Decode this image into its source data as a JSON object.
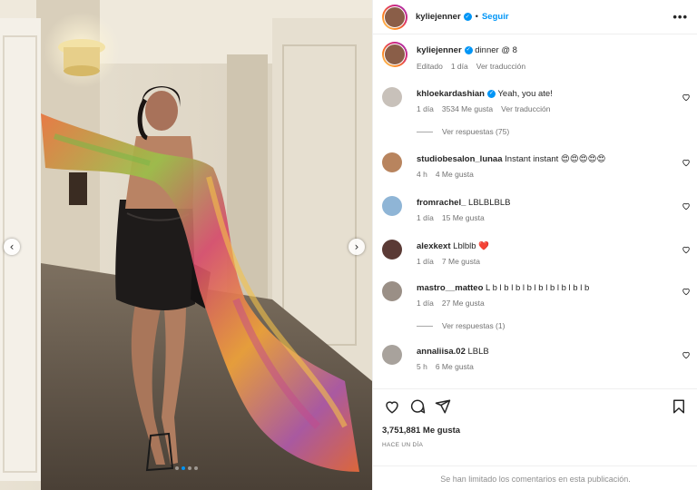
{
  "post": {
    "author": "kyliejenner",
    "follow_label": "Seguir",
    "separator": "•",
    "more_label": "•••"
  },
  "caption": {
    "username": "kyliejenner",
    "text": "dinner @ 8",
    "edited": "Editado",
    "time": "1 día",
    "translate": "Ver traducción"
  },
  "comments": [
    {
      "username": "khloekardashian",
      "verified": true,
      "text": "Yeah, you ate!",
      "time": "1 día",
      "likes": "3534 Me gusta",
      "translate": "Ver traducción",
      "replies": "Ver respuestas (75)"
    },
    {
      "username": "studiobesalon_lunaa",
      "verified": false,
      "text": "Instant instant 😍😍😍😍😍",
      "time": "4 h",
      "likes": "4 Me gusta"
    },
    {
      "username": "fromrachel_",
      "verified": false,
      "text": "LBLBLBLB",
      "time": "1 día",
      "likes": "15 Me gusta"
    },
    {
      "username": "alexkext",
      "verified": false,
      "text": "Lblblb ❤️",
      "time": "1 día",
      "likes": "7 Me gusta"
    },
    {
      "username": "mastro__matteo",
      "verified": false,
      "text": "L b l b l b l b l b l b l b l b l b",
      "time": "1 día",
      "likes": "27 Me gusta",
      "replies": "Ver respuestas (1)"
    },
    {
      "username": "annaliisa.02",
      "verified": false,
      "text": "LBLB",
      "time": "5 h",
      "likes": "6 Me gusta"
    }
  ],
  "footer": {
    "likes": "3,751,881 Me gusta",
    "time_ago": "HACE UN DÍA",
    "comments_limited": "Se han limitado los comentarios en esta publicación."
  },
  "carousel": {
    "prev_icon": "‹",
    "next_icon": "›",
    "slides": 4,
    "active_slide": 2
  },
  "colors": {
    "accent": "#0095f6",
    "meta": "#737373",
    "text": "#262626"
  },
  "icons": [
    "heart-icon",
    "comment-icon",
    "share-icon",
    "bookmark-icon",
    "verified-icon",
    "more-icon",
    "chevron-left-icon",
    "chevron-right-icon"
  ]
}
